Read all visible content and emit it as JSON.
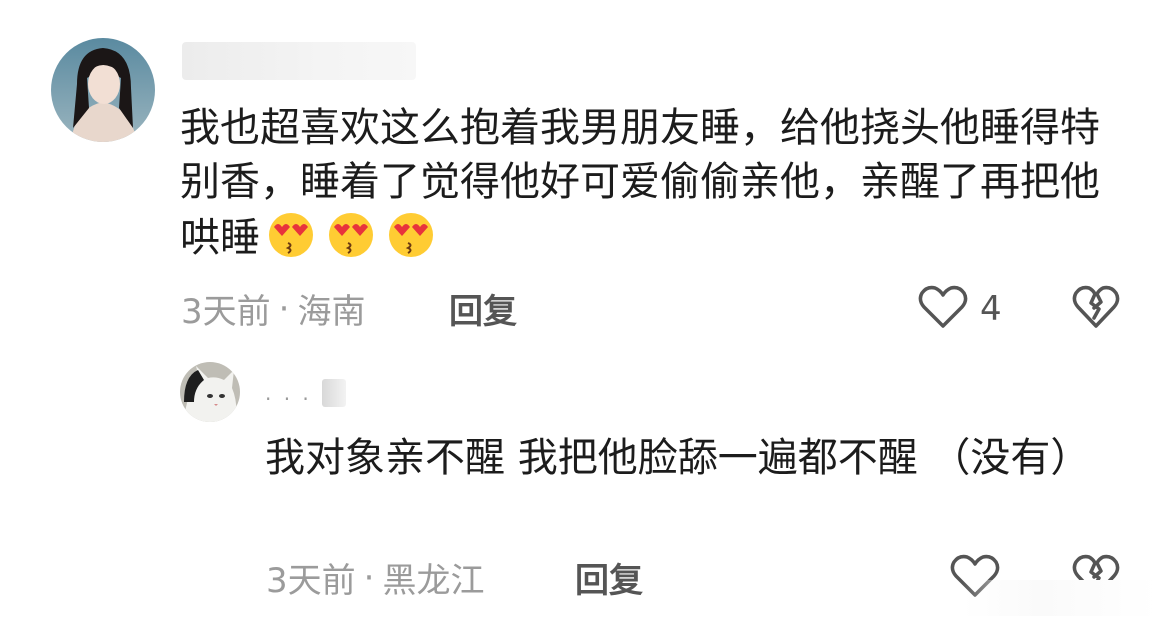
{
  "main_comment": {
    "avatar_icon": "user-avatar-photo",
    "text": "我也超喜欢这么抱着我男朋友睡，给他挠头他睡得特别香，睡着了觉得他好可爱偷偷亲他，亲醒了再把他哄睡",
    "emojis": [
      "heart-eyes-kiss-emoji",
      "heart-eyes-kiss-emoji",
      "heart-eyes-kiss-emoji"
    ],
    "time": "3天前",
    "separator": "·",
    "location": "海南",
    "reply_label": "回复",
    "like_icon": "heart-outline-icon",
    "like_count": "4",
    "dislike_icon": "broken-heart-icon"
  },
  "reply_comment": {
    "avatar_icon": "cat-avatar-photo",
    "username": ". . .",
    "text": "我对象亲不醒 我把他脸舔一遍都不醒 （没有）",
    "time": "3天前",
    "separator": "·",
    "location": "黑龙江",
    "reply_label": "回复",
    "like_icon": "heart-outline-icon",
    "dislike_icon": "broken-heart-icon"
  },
  "colors": {
    "text_primary": "#1c1c1c",
    "text_meta": "#9b9b9b",
    "reply_label": "#555555",
    "icon_stroke": "#555555"
  }
}
